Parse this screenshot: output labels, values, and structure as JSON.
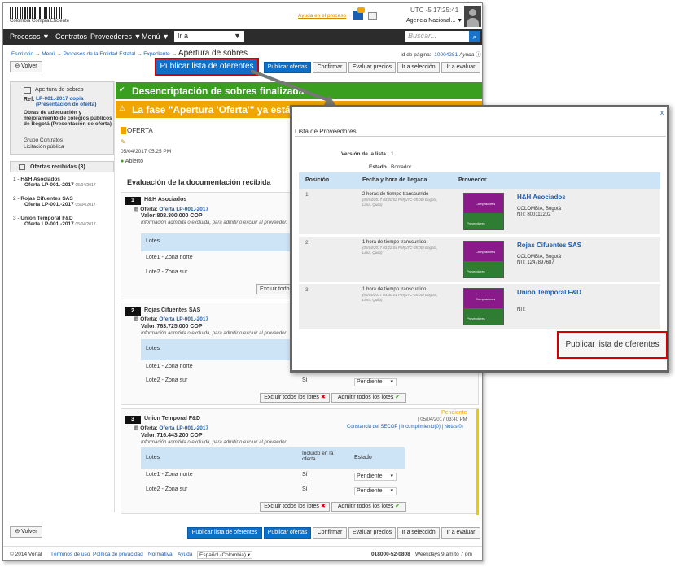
{
  "header": {
    "logo_text": "Colombia Compra Eficiente",
    "ayuda": "Ayuda en el proceso",
    "time": "UTC -5 17:25:41",
    "agency": "Agencia Nacional..."
  },
  "nav": {
    "items": [
      "Procesos",
      "Contratos",
      "Proveedores",
      "Menú"
    ],
    "ir_a": "Ir a",
    "search_placeholder": "Buscar..."
  },
  "breadcrumb": {
    "items": [
      "Escritorio",
      "Menú",
      "Procesos de la Entidad Estatal",
      "Expediente"
    ],
    "current": "Apertura de sobres",
    "page_id_label": "Id de página::",
    "page_id": "10004281",
    "help": "Ayuda"
  },
  "toolbar": {
    "back": "Volver",
    "publish_list": "Publicar lista de oferentes",
    "publish_offers": "Publicar ofertas",
    "confirm": "Confirmar",
    "evaluate": "Evaluar precios",
    "goto_selection": "Ir a selección",
    "goto_eval": "Ir a evaluar"
  },
  "left": {
    "title": "Apertura de sobres",
    "ref_label": "Ref:",
    "ref": "LP-001.-2017 copia (Presentación de oferta)",
    "desc": "Obras de adecuación y mejoramiento de colegios públicos de Bogotá (Presentación de oferta)",
    "group": "Grupo Contratos",
    "type": "Licitación pública",
    "offers_title": "Ofertas recibidas (3)",
    "offers": [
      {
        "n": "1 -",
        "name": "H&H Asociados",
        "ref": "Oferta LP-001.-2017",
        "date": "05/04/2017"
      },
      {
        "n": "2 -",
        "name": "Rojas Cifuentes SAS",
        "ref": "Oferta LP-001.-2017",
        "date": "05/04/2017"
      },
      {
        "n": "3 -",
        "name": "Union Temporal F&D",
        "ref": "Oferta LP-001.-2017",
        "date": "05/04/2017"
      }
    ]
  },
  "banners": {
    "green": "Desencriptación de sobres finalizada",
    "orange": "La fase \"Apertura 'Oferta'\" ya está abierta"
  },
  "main": {
    "oferta": "OFERTA",
    "date": "05/04/2017 05:25 PM",
    "status": "Abierto",
    "eval_title": "Evaluación de la documentación recibida",
    "oferta_label": "Oferta:",
    "valor_label": "Valor:",
    "note": "Información admitida o excluida, para admitir o excluir al proveedor.",
    "lotes": "Lotes",
    "incluido": "Incluido en la oferta",
    "estado": "Estado",
    "lote1": "Lote1 - Zona norte",
    "lote2": "Lote2 - Zona sur",
    "si": "Sí",
    "pendiente": "Pendiente",
    "exclude_all": "Excluir todos los lotes",
    "admit_all": "Admitir todos los lotes",
    "pendiente_status": "Pendiente",
    "date3": "| 05/04/2017 03:40 PM",
    "links3": "Constancia del SECOP | Incumplimiento(0) | Notas(0)",
    "suppliers": [
      {
        "n": "1",
        "name": "H&H Asociados",
        "oferta": "Oferta LP-001.-2017",
        "valor": "808.300.000 COP"
      },
      {
        "n": "2",
        "name": "Rojas Cifuentes SAS",
        "oferta": "Oferta LP-001.-2017",
        "valor": "763.725.000 COP"
      },
      {
        "n": "3",
        "name": "Union Temporal F&D",
        "oferta": "Oferta LP-001.-2017",
        "valor": "716.443.200 COP"
      }
    ]
  },
  "footer": {
    "copyright": "© 2014 Vortal",
    "links": [
      "Términos de uso",
      "Política de privacidad",
      "Normativa",
      "Ayuda",
      "Español (Colombia)"
    ],
    "phone": "018000-52-0808",
    "hours": "Weekdays 9 am to 7 pm"
  },
  "modal": {
    "title": "Lista de Proveedores",
    "version_label": "Versión de la lista",
    "version": "1",
    "estado_label": "Estado",
    "estado": "Borrador",
    "col_pos": "Posición",
    "col_fecha": "Fecha y hora de llegada",
    "col_prov": "Proveedor",
    "logo_top": "Compradores",
    "logo_bottom": "Proveedores",
    "close": "x",
    "rows": [
      {
        "pos": "1",
        "time": "2 horas de tiempo transcurrido",
        "stamp": "(05/04/2017 03:20:02 PM(UTC-05:00) Bogotá, Lima, Quito)",
        "name": "H&H Asociados",
        "loc": "COLOMBIA, Bogotá",
        "nit": "NIT: 800111202"
      },
      {
        "pos": "2",
        "time": "1 hora de tiempo transcurrido",
        "stamp": "(05/04/2017 03:22:04 PM(UTC-05:00) Bogotá, Lima, Quito)",
        "name": "Rojas Cifuentes SAS",
        "loc": "COLOMBIA, Bogotá",
        "nit": "NIT: 1247897687"
      },
      {
        "pos": "3",
        "time": "1 hora de tiempo transcurrido",
        "stamp": "(05/04/2017 03:40:01 PM(UTC-05:00) Bogotá, Lima, Quito)",
        "name": "Union Temporal F&D",
        "loc": "",
        "nit": "NIT:"
      }
    ]
  },
  "callout": {
    "publish": "Publicar lista de oferentes"
  }
}
